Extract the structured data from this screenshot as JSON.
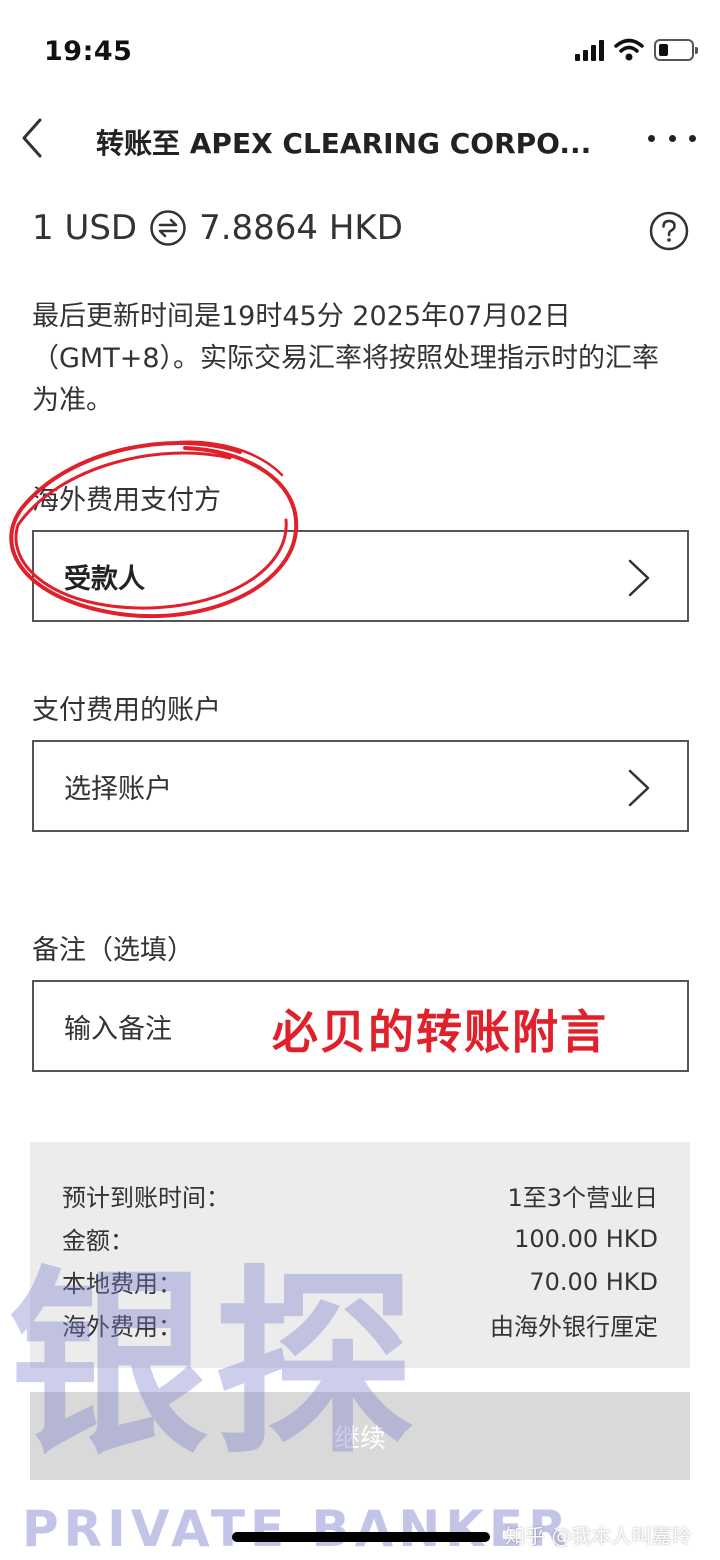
{
  "status_bar": {
    "time": "19:45"
  },
  "header": {
    "title": "转账至 APEX CLEARING CORPO..."
  },
  "rate": {
    "from": "1 USD",
    "to": "7.8864 HKD"
  },
  "rate_note": "最后更新时间是19时45分 2025年07月02日（GMT+8）。实际交易汇率将按照处理指示时的汇率为准。",
  "fee_payer": {
    "label": "海外费用支付方",
    "value": "受款人"
  },
  "fee_account": {
    "label": "支付费用的账户",
    "placeholder": "选择账户"
  },
  "remark": {
    "label": "备注（选填）",
    "placeholder": "输入备注",
    "annotation": "必贝的转账附言"
  },
  "summary": {
    "rows": [
      {
        "label": "预计到账时间：",
        "value": "1至3个营业日"
      },
      {
        "label": "金额：",
        "value": "100.00 HKD"
      },
      {
        "label": "本地费用：",
        "value": "70.00 HKD"
      },
      {
        "label": "海外费用：",
        "value": "由海外银行厘定"
      }
    ]
  },
  "continue_label": "继续",
  "watermark": {
    "big": "银探",
    "sub": "PRIVATE BANKER",
    "credit": "知乎 @我本人叫嘉玲"
  },
  "colors": {
    "annotation_red": "#e0202a",
    "watermark": "#787dcd",
    "summary_bg": "#ececec"
  },
  "icons": [
    "signal-icon",
    "wifi-icon",
    "battery-icon",
    "back-chevron-icon",
    "more-icon",
    "exchange-icon",
    "help-icon",
    "chevron-right-icon"
  ]
}
